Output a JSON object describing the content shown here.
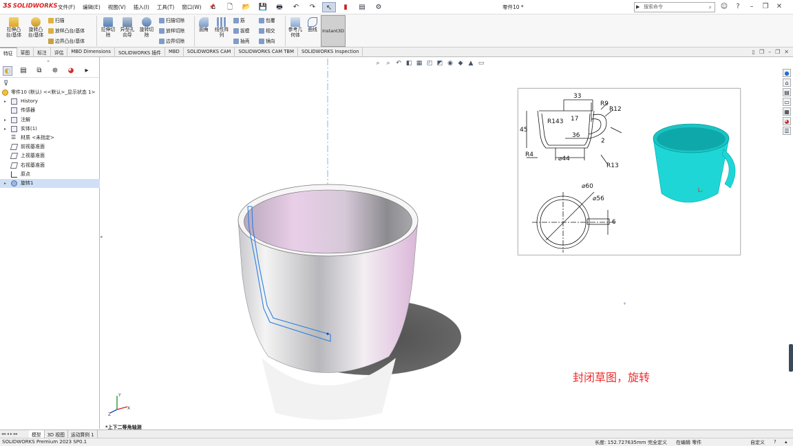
{
  "app": {
    "logo": "SOLIDWORKS",
    "doc_title": "零件10 *"
  },
  "menu": [
    "文件(F)",
    "编辑(E)",
    "视图(V)",
    "插入(I)",
    "工具(T)",
    "窗口(W)"
  ],
  "quick_access": [
    "home-icon",
    "new-icon",
    "open-icon",
    "save-icon",
    "print-icon",
    "undo-icon",
    "select-icon",
    "traffic-light-icon",
    "file-properties-icon",
    "options-icon"
  ],
  "search": {
    "placeholder": "搜索命令"
  },
  "ribbon": {
    "extruded_boss": "拉伸凸\n台/基体",
    "revolved_boss": "旋转凸\n台/基体",
    "sweep": "扫描",
    "loft": "放样凸台/基体",
    "boundary_boss": "边界凸台/基体",
    "extruded_cut": "拉伸切\n除",
    "hole_wizard": "异型孔\n向导",
    "revolved_cut": "旋转切\n除",
    "swept_cut": "扫描切除",
    "lofted_cut": "放样切除",
    "boundary_cut": "边界切除",
    "fillet": "圆角",
    "linear_pattern": "线性阵\n列",
    "rib": "筋",
    "draft": "拔模",
    "shell": "抽壳",
    "wrap": "包覆",
    "intersect": "相交",
    "mirror": "镜向",
    "reference_geometry": "参考几\n何体",
    "curves": "曲线",
    "instant3d": "Instant3D"
  },
  "tabs": [
    "特征",
    "草图",
    "标注",
    "评估",
    "MBD Dimensions",
    "SOLIDWORKS 插件",
    "MBD",
    "SOLIDWORKS CAM",
    "SOLIDWORKS CAM TBM",
    "SOLIDWORKS Inspection"
  ],
  "tree": {
    "root": "零件10 (默认) <<默认>_显示状态 1>",
    "items": [
      "History",
      "传感器",
      "注解",
      "实体(1)",
      "材质 <未指定>",
      "前视基准面",
      "上视基准面",
      "右视基准面",
      "原点",
      "旋转1"
    ]
  },
  "reference_drawing": {
    "dims": [
      "33",
      "R9",
      "R12",
      "17",
      "45",
      "R143",
      "36",
      "R4",
      "⌀44",
      "R13",
      "2",
      "⌀60",
      "⌀56",
      "6"
    ]
  },
  "caption": "封闭草图，旋转",
  "view_label": "*上下二等角轴测",
  "bottom_tabs": [
    "模型",
    "3D 视图",
    "运动算例 1"
  ],
  "status": {
    "product": "SOLIDWORKS Premium 2023 SP0.1",
    "length": "长度: 152.727635mm",
    "definition": "完全定义",
    "editing": "在编辑 零件",
    "custom": "自定义"
  },
  "colors": {
    "accent": "#1f6fd0",
    "caption": "#e8302e",
    "cup_preview": "#1fd6d6"
  }
}
